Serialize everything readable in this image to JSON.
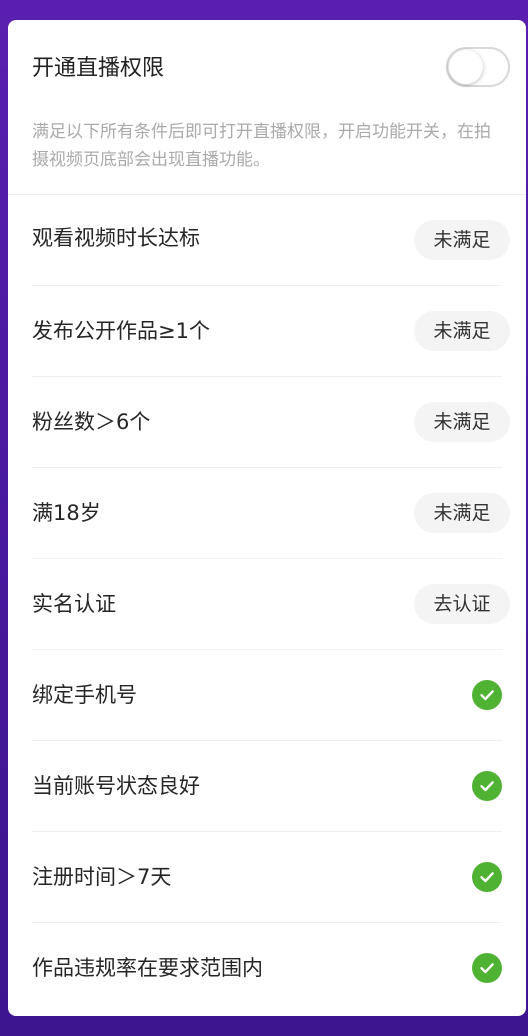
{
  "header": {
    "title": "开通直播权限",
    "description": "满足以下所有条件后即可打开直播权限，开启功能开关，在拍摄视频页底部会出现直播功能。",
    "toggle_on": false
  },
  "requirements": [
    {
      "label": "观看视频时长达标",
      "status": "未满足",
      "met": false
    },
    {
      "label": "发布公开作品≥1个",
      "status": "未满足",
      "met": false
    },
    {
      "label": "粉丝数＞6个",
      "status": "未满足",
      "met": false
    },
    {
      "label": "满18岁",
      "status": "未满足",
      "met": false
    },
    {
      "label": "实名认证",
      "status": "去认证",
      "met": false
    },
    {
      "label": "绑定手机号",
      "status": "",
      "met": true
    },
    {
      "label": "当前账号状态良好",
      "status": "",
      "met": true
    },
    {
      "label": "注册时间＞7天",
      "status": "",
      "met": true
    },
    {
      "label": "作品违规率在要求范围内",
      "status": "",
      "met": true
    }
  ],
  "colors": {
    "check_green": "#4fb233",
    "background_purple": "#4a1aa0"
  },
  "icons": {
    "met": "check-circle-icon"
  }
}
